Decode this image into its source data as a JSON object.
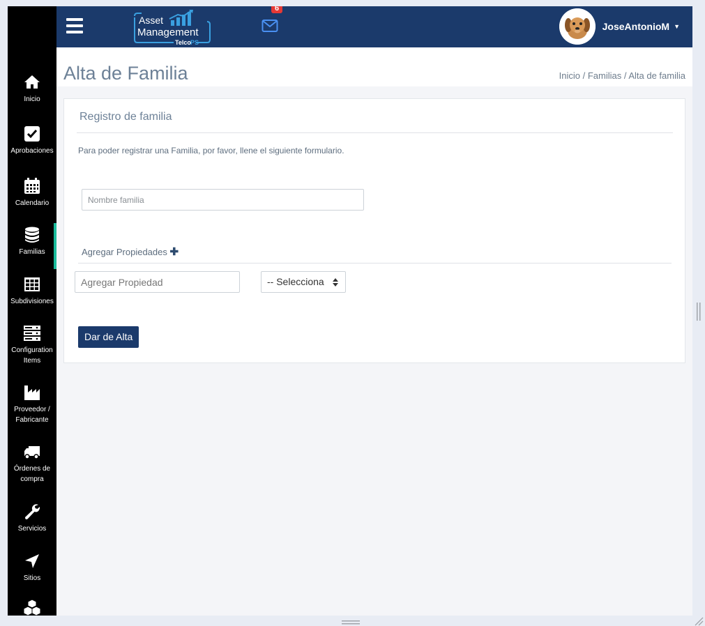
{
  "topbar": {
    "logo_line1": "Asset",
    "logo_line2": "Management",
    "logo_sub1": "Telco",
    "logo_sub2": "PS",
    "mail_badge": "6",
    "user_name": "JoseAntonioM",
    "accent_color": "#1b3a6b"
  },
  "sidebar": {
    "items": [
      {
        "label": "Inicio",
        "icon": "home-icon"
      },
      {
        "label": "Aprobaciones",
        "icon": "check-square-icon"
      },
      {
        "label": "Calendario",
        "icon": "calendar-icon"
      },
      {
        "label": "Familias",
        "icon": "database-icon",
        "active": true
      },
      {
        "label": "Subdivisiones",
        "icon": "table-icon"
      },
      {
        "label": "Configuration Items",
        "icon": "server-icon"
      },
      {
        "label": "Proveedor / Fabricante",
        "icon": "factory-icon"
      },
      {
        "label": "Órdenes de compra",
        "icon": "truck-icon"
      },
      {
        "label": "Servicios",
        "icon": "wrench-icon"
      },
      {
        "label": "Sitios",
        "icon": "location-arrow-icon"
      },
      {
        "label": "",
        "icon": "cubes-icon"
      }
    ],
    "active_color": "#1abc9c"
  },
  "page": {
    "title": "Alta de Familia",
    "breadcrumb": [
      "Inicio",
      "Familias",
      "Alta de familia"
    ]
  },
  "form": {
    "card_title": "Registro de familia",
    "description": "Para poder registrar una Familia, por favor, llene el siguiente formulario.",
    "name_placeholder": "Nombre familia",
    "add_properties_label": "Agregar Propiedades",
    "property_placeholder": "Agregar Propiedad",
    "select_value": "-- Selecciona",
    "submit_label": "Dar de Alta"
  }
}
